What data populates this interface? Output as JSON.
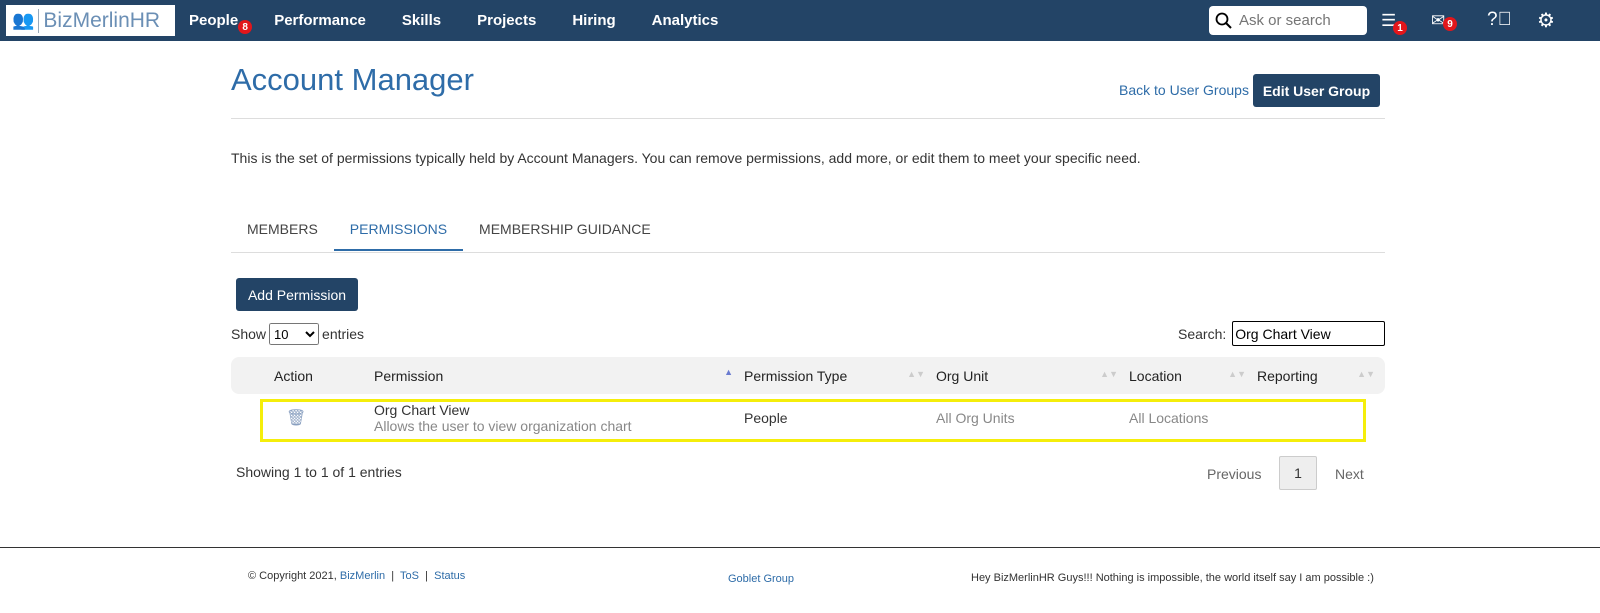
{
  "nav": {
    "logo": "BizMerlinHR",
    "items": [
      {
        "label": "People",
        "badge": "8"
      },
      {
        "label": "Performance"
      },
      {
        "label": "Skills"
      },
      {
        "label": "Projects"
      },
      {
        "label": "Hiring"
      },
      {
        "label": "Analytics"
      }
    ],
    "search_placeholder": "Ask or search",
    "layers_badge": "1",
    "mail_badge": "9"
  },
  "header": {
    "title": "Account Manager",
    "back_link": "Back to User Groups",
    "edit_button": "Edit User Group"
  },
  "description": "This is the set of permissions typically held by Account Managers. You can remove permissions, add more, or edit them to meet your specific need.",
  "tabs": [
    {
      "label": "MEMBERS"
    },
    {
      "label": "PERMISSIONS",
      "active": true
    },
    {
      "label": "MEMBERSHIP GUIDANCE"
    }
  ],
  "add_button": "Add Permission",
  "length": {
    "show": "Show",
    "value": "10",
    "entries": "entries"
  },
  "search": {
    "label": "Search:",
    "value": "Org Chart View"
  },
  "table": {
    "columns": [
      "Action",
      "Permission",
      "Permission Type",
      "Org Unit",
      "Location",
      "Reporting"
    ],
    "rows": [
      {
        "permission": "Org Chart View",
        "description": "Allows the user to view organization chart",
        "type": "People",
        "org_unit": "All Org Units",
        "location": "All Locations",
        "reporting": ""
      }
    ]
  },
  "info": "Showing 1 to 1 of 1 entries",
  "pagination": {
    "previous": "Previous",
    "page": "1",
    "next": "Next"
  },
  "footer": {
    "copyright": "© Copyright 2021,",
    "company": "BizMerlin",
    "tos": "ToS",
    "status": "Status",
    "sep": "|",
    "center": "Goblet Group",
    "message": "Hey BizMerlinHR Guys!!! Nothing is impossible, the world itself say I am possible :)"
  },
  "colors": {
    "nav": "#234466",
    "accent": "#2e6ca8",
    "highlight": "#f5ee0b",
    "badge": "#e2161b"
  }
}
